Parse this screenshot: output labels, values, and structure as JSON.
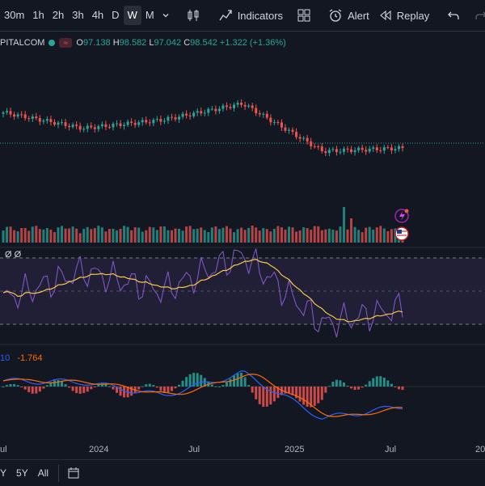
{
  "toolbar": {
    "timeframes": [
      "30m",
      "1h",
      "2h",
      "3h",
      "4h",
      "D",
      "W",
      "M"
    ],
    "active_timeframe": "W",
    "indicators_label": "Indicators",
    "alert_label": "Alert",
    "replay_label": "Replay"
  },
  "legend": {
    "symbol": "PITALCOM",
    "wave_badge": "≈",
    "open_key": "O",
    "open": "97.138",
    "high_key": "H",
    "high": "98.582",
    "low_key": "L",
    "low": "97.042",
    "close_key": "C",
    "close": "98.542",
    "change": "+1.322 (+1.36%)"
  },
  "rsi": {
    "label": "Ø Ø"
  },
  "macd": {
    "value1": "10",
    "value2": "-1.764"
  },
  "x_axis": {
    "labels": [
      "ul",
      "2024",
      "Jul",
      "2025",
      "Jul",
      "20"
    ]
  },
  "bottombar": {
    "ranges": [
      "Y",
      "5Y",
      "All"
    ]
  },
  "colors": {
    "up": "#26a69a",
    "down": "#ef5350",
    "rsi_line": "#7e57c2",
    "rsi_ma": "#f7c844",
    "macd_line": "#2962ff",
    "signal_line": "#ff6d00"
  },
  "chart_data": {
    "type": "line",
    "x": [
      "2023-07",
      "2024-01",
      "2024-07",
      "2025-01",
      "2025-07"
    ],
    "price": [
      106.2,
      102.8,
      104.6,
      108.1,
      97.9,
      98.54
    ],
    "rsi": [
      45,
      62,
      50,
      72,
      30,
      40
    ],
    "macd": [
      0.5,
      0.4,
      -0.8,
      1.2,
      -2.8,
      -1.76
    ]
  }
}
